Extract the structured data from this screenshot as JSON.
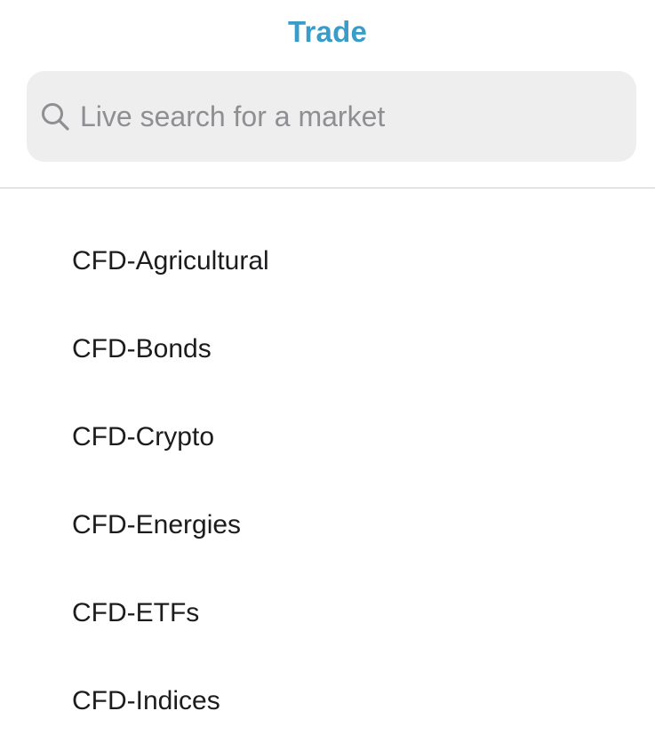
{
  "header": {
    "title": "Trade"
  },
  "search": {
    "placeholder": "Live search for a market",
    "value": ""
  },
  "markets": [
    {
      "label": "CFD-Agricultural"
    },
    {
      "label": "CFD-Bonds"
    },
    {
      "label": "CFD-Crypto"
    },
    {
      "label": "CFD-Energies"
    },
    {
      "label": "CFD-ETFs"
    },
    {
      "label": "CFD-Indices"
    }
  ],
  "colors": {
    "accent": "#3a9cc9",
    "search_bg": "#eeeeef",
    "placeholder": "#8e8e93",
    "text": "#1c1c1e",
    "divider": "#cfcfd2"
  },
  "icons": {
    "search": "search-icon"
  }
}
